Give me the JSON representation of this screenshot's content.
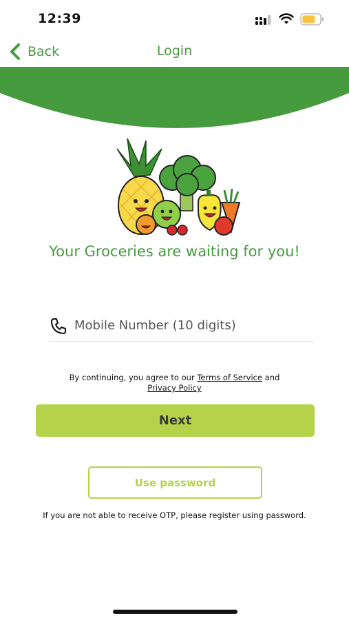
{
  "status_bar": {
    "time": "12:39"
  },
  "nav": {
    "back_label": "Back",
    "title": "Login"
  },
  "colors": {
    "brand_green": "#479b3f",
    "accent_lime": "#b5d24b",
    "battery_yellow": "#f6c343"
  },
  "hero": {
    "tagline": "Your Groceries are waiting for you!"
  },
  "login_form": {
    "phone_placeholder": "Mobile Number (10 digits)",
    "phone_value": "",
    "terms_prefix": "By continuing, you agree to our",
    "terms_link": "Terms of Service",
    "terms_and": "and",
    "privacy_link": "Privacy Policy",
    "next_label": "Next",
    "use_password_label": "Use password",
    "otp_note": "If you are not able to receive OTP, please register using password."
  },
  "icons": {
    "back": "chevron-left-icon",
    "phone": "phone-icon",
    "signal": "signal-icon",
    "wifi": "wifi-icon",
    "battery": "battery-icon"
  }
}
